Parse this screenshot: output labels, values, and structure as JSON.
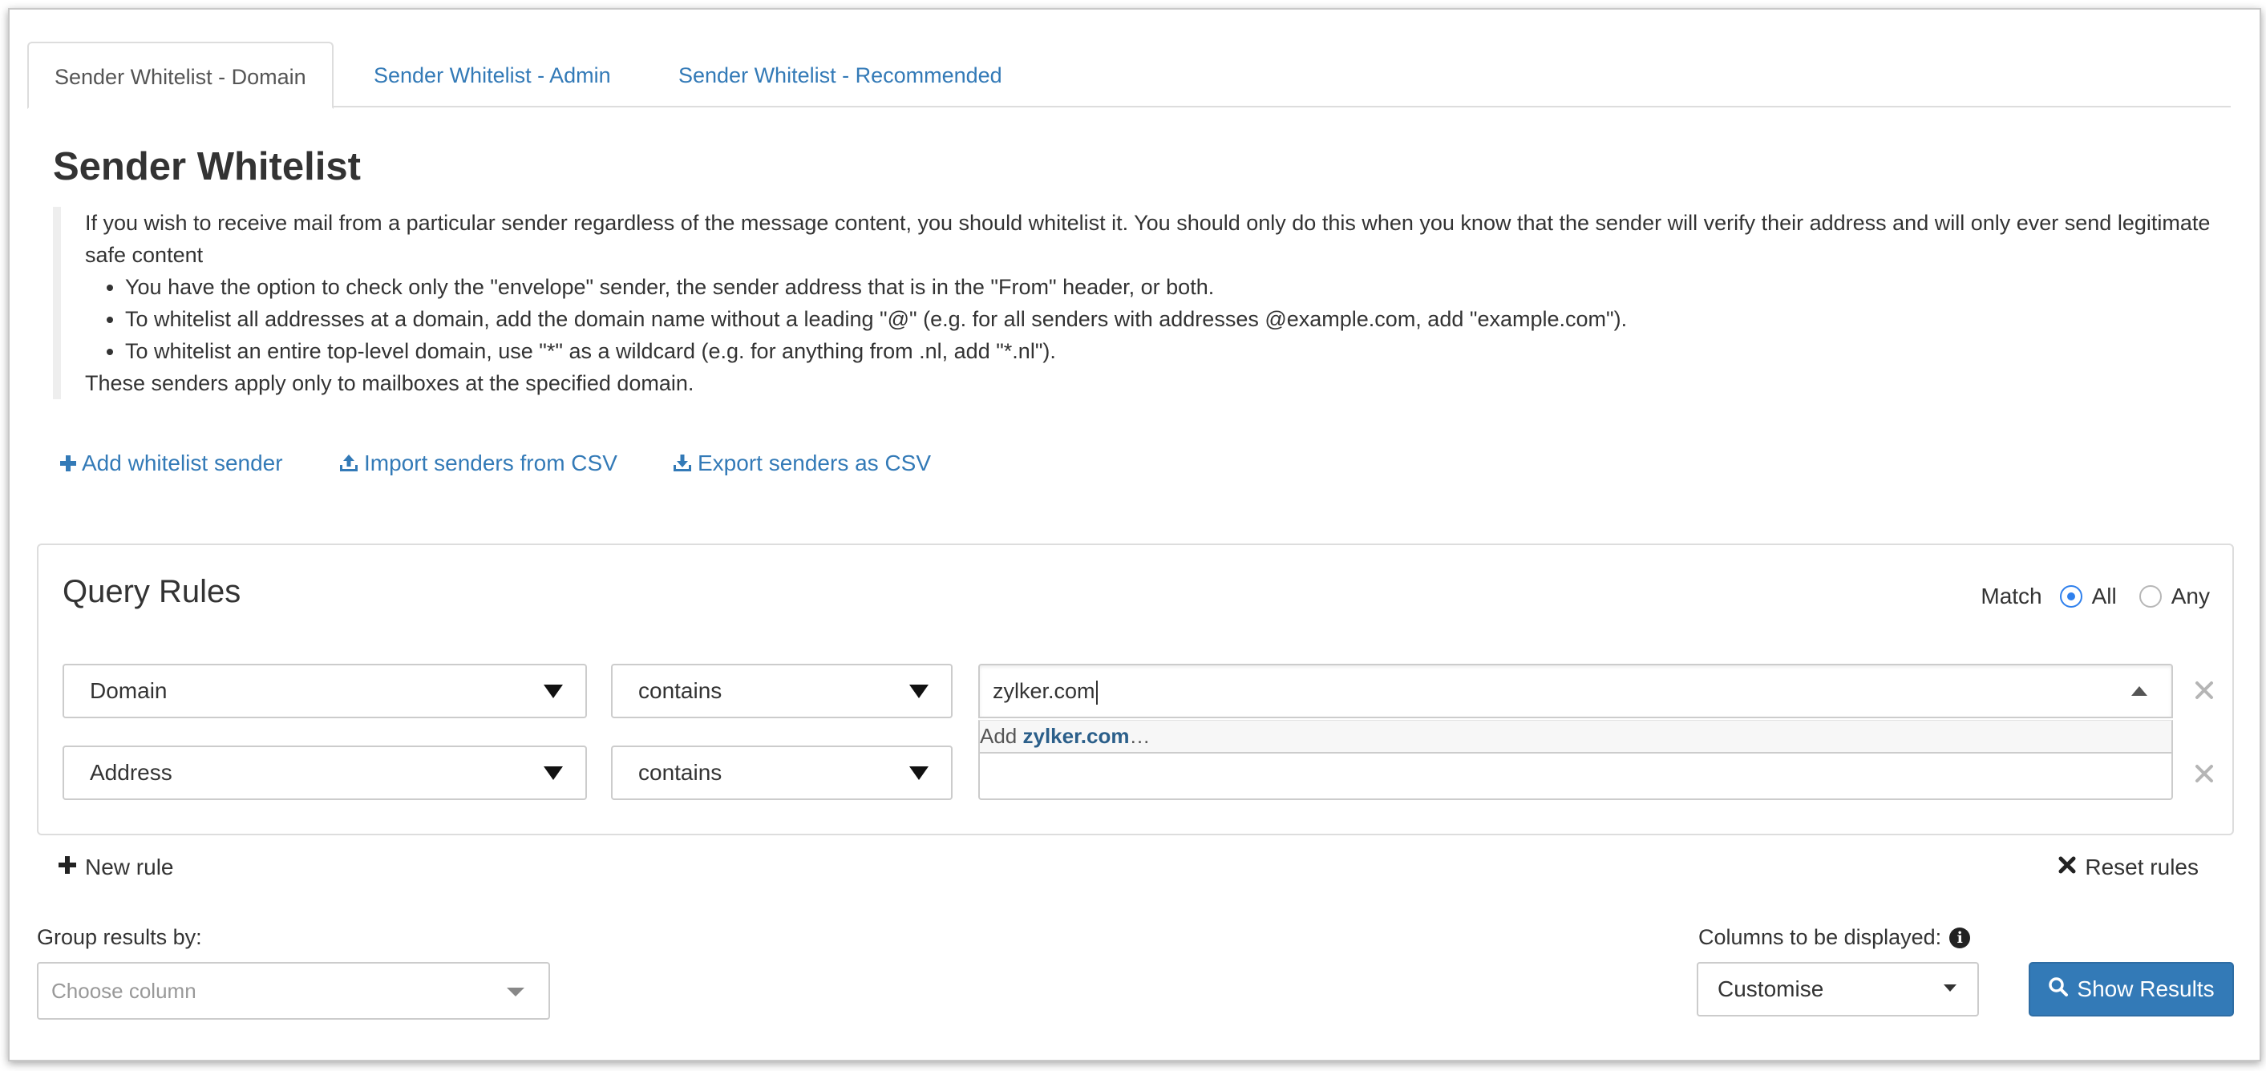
{
  "tabs": [
    {
      "label": "Sender Whitelist - Domain",
      "active": true
    },
    {
      "label": "Sender Whitelist - Admin",
      "active": false
    },
    {
      "label": "Sender Whitelist - Recommended",
      "active": false
    }
  ],
  "page": {
    "title": "Sender Whitelist",
    "intro": "If you wish to receive mail from a particular sender regardless of the message content, you should whitelist it. You should only do this when you know that the sender will verify their address and will only ever send legitimate safe content",
    "bullets": [
      "You have the option to check only the \"envelope\" sender, the sender address that is in the \"From\" header, or both.",
      "To whitelist all addresses at a domain, add the domain name without a leading \"@\" (e.g. for all senders with addresses @example.com, add \"example.com\").",
      "To whitelist an entire top-level domain, use \"*\" as a wildcard (e.g. for anything from .nl, add \"*.nl\")."
    ],
    "footer_note": "These senders apply only to mailboxes at the specified domain."
  },
  "actions": {
    "add": "Add whitelist sender",
    "import": "Import senders from CSV",
    "export": "Export senders as CSV"
  },
  "query": {
    "title": "Query Rules",
    "match_label": "Match",
    "match_options": [
      "All",
      "Any"
    ],
    "match_selected": "All",
    "rules": [
      {
        "field": "Domain",
        "operator": "contains",
        "value": "zylker.com"
      },
      {
        "field": "Address",
        "operator": "contains",
        "value": ""
      }
    ],
    "suggestion_prefix": "Add",
    "suggestion_value": "zylker.com",
    "suggestion_suffix": "…"
  },
  "controls": {
    "new_rule": "New rule",
    "reset_rules": "Reset rules",
    "group_label": "Group results by:",
    "group_placeholder": "Choose column",
    "columns_label": "Columns to be displayed:",
    "columns_value": "Customise",
    "show_results": "Show Results"
  },
  "colors": {
    "link": "#337ab7",
    "primary_button": "#337ab7",
    "radio_checked": "#2f80ed"
  },
  "icons": [
    "plus-icon",
    "upload-icon",
    "download-icon",
    "close-icon",
    "info-icon",
    "search-icon"
  ]
}
